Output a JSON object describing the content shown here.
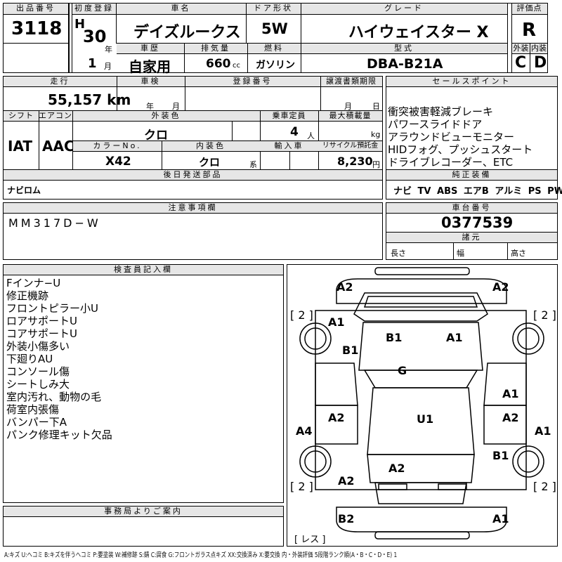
{
  "header": {
    "lot_label": "出品番号",
    "lot_value": "3118",
    "first_reg_label": "初度登録",
    "era": "H",
    "year": "30",
    "year_unit": "年",
    "month": "1",
    "month_unit": "月",
    "name_label": "車名",
    "name_value": "デイズルークス",
    "door_label": "ドア形状",
    "door_value": "5W",
    "grade_label": "グレード",
    "grade_value": "ハイウェイスター X",
    "score_label": "評価点",
    "score_value": "R",
    "history_label": "車歴",
    "history_value": "自家用",
    "displacement_label": "排気量",
    "displacement_value": "660",
    "displacement_unit": "cc",
    "fuel_label": "燃料",
    "fuel_value": "ガソリン",
    "model_label": "型式",
    "model_value": "DBA-B21A",
    "ext_label": "外装",
    "ext_value": "C",
    "int_label": "内装",
    "int_value": "D"
  },
  "row2": {
    "mileage_label": "走行",
    "mileage_value": "55,157",
    "mileage_unit": "km",
    "inspection_label": "車検",
    "insp_year_unit": "年",
    "insp_month_unit": "月",
    "regno_label": "登録番号",
    "transfer_label": "譲渡書類期限",
    "transfer_month_unit": "月",
    "transfer_day_unit": "日",
    "sales_label": "セールスポイント",
    "sales_points": [
      "衝突被害軽減ブレーキ",
      "パワースライドドア",
      "アラウンドビューモニター",
      "HIDフォグ、プッシュスタート",
      "ドライブレコーダー、ETC"
    ]
  },
  "row3": {
    "shift_label": "シフト",
    "shift_value": "IAT",
    "ac_label": "エアコン",
    "ac_value": "AAC",
    "color_label": "外装色",
    "color_value": "クロ",
    "capacity_label": "乗車定員",
    "capacity_value": "4",
    "capacity_unit": "人",
    "load_label": "最大積載量",
    "load_unit": "kg",
    "colorno_label": "カラーNo.",
    "colorno_value": "X42",
    "intcolor_label": "内装色",
    "intcolor_value": "クロ",
    "intcolor_unit": "系",
    "import_label": "輸入車",
    "recycle_label": "リサイクル預託金",
    "recycle_value": "8,230",
    "recycle_unit": "円",
    "later_label": "後日発送部品",
    "later_value": "ナビロム",
    "equip_label": "純正装備",
    "equip_items": [
      "ナビ",
      "TV",
      "ABS",
      "エアB",
      "アルミ",
      "PS",
      "PW"
    ]
  },
  "notes": {
    "label": "注意事項欄",
    "value": "MM317D−W",
    "chassis_label": "車台番号",
    "chassis_value": "0377539",
    "dims_label": "諸元",
    "length_label": "長さ",
    "width_label": "幅",
    "height_label": "高さ"
  },
  "inspector": {
    "label": "検査員記入欄",
    "lines": [
      "Fインナ−U",
      "修正機跡",
      "フロントピラー小U",
      "ロアサポートU",
      "コアサポートU",
      "外装小傷多い",
      "下廻りAU",
      "コンソール傷",
      "シートしみ大",
      "室内汚れ、動物の毛",
      "荷室内張傷",
      "バンパー下A",
      "パンク修理キット欠品"
    ]
  },
  "office": {
    "label": "事務局よりご案内"
  },
  "diagram": {
    "marks": [
      "A2",
      "A2",
      "[ 2 ]",
      "[ 2 ]",
      "A1",
      "B1",
      "A1",
      "B1",
      "G",
      "A1",
      "A2",
      "U1",
      "A2",
      "A4",
      "A1",
      "B1",
      "A2",
      "A2",
      "[ 2 ]",
      "[ 2 ]",
      "B2",
      "A1",
      "[ レス ]"
    ]
  },
  "legend": "A:キズ U:ヘコミ B:キズを伴うヘコミ P:要塗装 W:補修跡 S:錆 C:腐食 G:フロントガラス点キズ XX:交換済み X:要交換 内・外装評価 5段階ランク順(A・B・C・D・E) 1"
}
